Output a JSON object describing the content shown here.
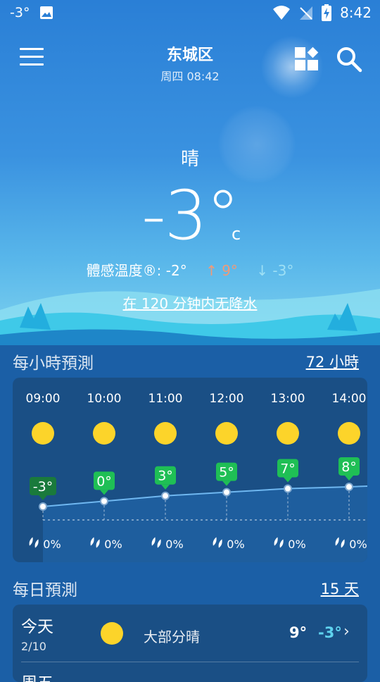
{
  "status": {
    "temp": "-3°",
    "time": "8:42"
  },
  "header": {
    "city": "东城区",
    "datetime": "周四 08:42"
  },
  "current": {
    "condition": "晴",
    "temp": "-3°",
    "unit": "c",
    "feels_like": "體感溫度®: -2°",
    "high": "↑ 9°",
    "low": "↓ -3°",
    "precip_note": "在 120 分钟内无降水"
  },
  "hourly": {
    "title": "每小時預測",
    "link": "72 小時",
    "items": [
      {
        "time": "09:00",
        "temp": -3,
        "temp_label": "-3°",
        "precip": "0%"
      },
      {
        "time": "10:00",
        "temp": 0,
        "temp_label": "0°",
        "precip": "0%"
      },
      {
        "time": "11:00",
        "temp": 3,
        "temp_label": "3°",
        "precip": "0%"
      },
      {
        "time": "12:00",
        "temp": 5,
        "temp_label": "5°",
        "precip": "0%"
      },
      {
        "time": "13:00",
        "temp": 7,
        "temp_label": "7°",
        "precip": "0%"
      },
      {
        "time": "14:00",
        "temp": 8,
        "temp_label": "8°",
        "precip": "0%"
      }
    ]
  },
  "daily": {
    "title": "每日預測",
    "link": "15 天",
    "items": [
      {
        "day": "今天",
        "date": "2/10",
        "condition": "大部分晴",
        "high": "9°",
        "low": "-3°"
      },
      {
        "day": "周五"
      }
    ]
  },
  "colors": {
    "sun": "#fcd42a",
    "temp_badge_first": "#1a7a3c",
    "temp_badge": "#1fbf55",
    "low_temp": "#5fd3ef"
  }
}
